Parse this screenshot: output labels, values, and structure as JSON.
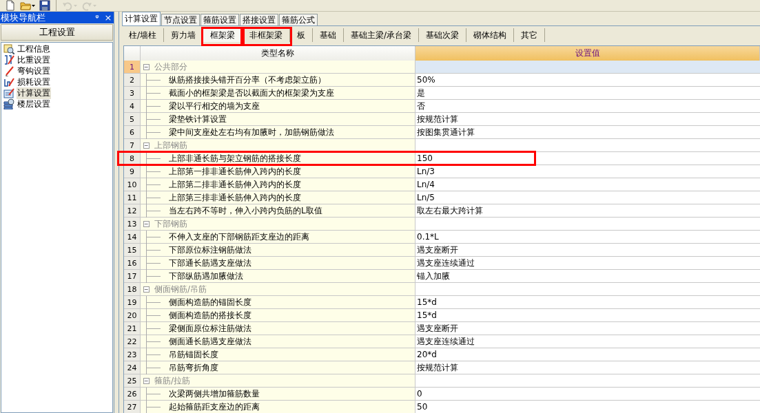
{
  "toolbar": {
    "buttons": [
      {
        "kind": "new",
        "disabled": false,
        "caret": false
      },
      {
        "kind": "open",
        "disabled": false,
        "caret": true
      },
      {
        "kind": "save",
        "disabled": false,
        "caret": false
      },
      {
        "kind": "undo",
        "disabled": true,
        "caret": true
      },
      {
        "kind": "redo",
        "disabled": true,
        "caret": true
      }
    ]
  },
  "nav_panel": {
    "title": "模块导航栏",
    "pin": "ᵠ",
    "close": "×",
    "section": "工程设置",
    "items": [
      {
        "label": "工程信息",
        "kind": "info",
        "selected": false
      },
      {
        "label": "比重设置",
        "kind": "weight",
        "selected": false
      },
      {
        "label": "弯钩设置",
        "kind": "hook",
        "selected": false
      },
      {
        "label": "损耗设置",
        "kind": "loss",
        "selected": false
      },
      {
        "label": "计算设置",
        "kind": "calc",
        "selected": true
      },
      {
        "label": "楼层设置",
        "kind": "floor",
        "selected": false
      }
    ]
  },
  "tabs": [
    {
      "label": "计算设置",
      "selected": true
    },
    {
      "label": "节点设置",
      "selected": false
    },
    {
      "label": "箍筋设置",
      "selected": false
    },
    {
      "label": "搭接设置",
      "selected": false
    },
    {
      "label": "箍筋公式",
      "selected": false
    }
  ],
  "subtabs": [
    {
      "label": "柱/墙柱",
      "selected": false,
      "highlighted": false
    },
    {
      "label": "剪力墙",
      "selected": false,
      "highlighted": false
    },
    {
      "label": "框架梁",
      "selected": true,
      "highlighted": true
    },
    {
      "label": "非框架梁",
      "selected": false,
      "highlighted": true
    },
    {
      "label": "板",
      "selected": false,
      "highlighted": false
    },
    {
      "label": "基础",
      "selected": false,
      "highlighted": false
    },
    {
      "label": "基础主梁/承台梁",
      "selected": false,
      "highlighted": false
    },
    {
      "label": "基础次梁",
      "selected": false,
      "highlighted": false
    },
    {
      "label": "砌体结构",
      "selected": false,
      "highlighted": false
    },
    {
      "label": "其它",
      "selected": false,
      "highlighted": false
    }
  ],
  "table": {
    "columns": [
      "类型名称",
      "设置值"
    ],
    "rows": [
      {
        "num": "1",
        "kind": "group",
        "toggle": "−",
        "name": "公共部分",
        "selected": true,
        "highlighted": false
      },
      {
        "num": "2",
        "kind": "item",
        "name": "纵筋搭接接头错开百分率（不考虑架立筋）",
        "value": "50%",
        "selected": false,
        "highlighted": false
      },
      {
        "num": "3",
        "kind": "item",
        "name": "截面小的框架梁是否以截面大的框架梁为支座",
        "value": "是",
        "selected": false,
        "highlighted": false
      },
      {
        "num": "4",
        "kind": "item",
        "name": "梁以平行相交的墙为支座",
        "value": "否",
        "selected": false,
        "highlighted": false
      },
      {
        "num": "5",
        "kind": "item",
        "name": "梁垫铁计算设置",
        "value": "按规范计算",
        "selected": false,
        "highlighted": false
      },
      {
        "num": "6",
        "kind": "item",
        "name": "梁中间支座处左右均有加腋时，加筋钢筋做法",
        "value": "按图集贯通计算",
        "selected": false,
        "highlighted": false
      },
      {
        "num": "7",
        "kind": "group",
        "toggle": "−",
        "name": "上部钢筋",
        "selected": false,
        "highlighted": false
      },
      {
        "num": "8",
        "kind": "item",
        "name": "上部非通长筋与架立钢筋的搭接长度",
        "value": "150",
        "selected": false,
        "highlighted": true
      },
      {
        "num": "9",
        "kind": "item",
        "name": "上部第一排非通长筋伸入跨内的长度",
        "value": "Ln/3",
        "selected": false,
        "highlighted": false
      },
      {
        "num": "10",
        "kind": "item",
        "name": "上部第二排非通长筋伸入跨内的长度",
        "value": "Ln/4",
        "selected": false,
        "highlighted": false
      },
      {
        "num": "11",
        "kind": "item",
        "name": "上部第三排非通长筋伸入跨内的长度",
        "value": "Ln/5",
        "selected": false,
        "highlighted": false
      },
      {
        "num": "12",
        "kind": "item",
        "name": "当左右跨不等时，伸入小跨内负筋的L取值",
        "value": "取左右最大跨计算",
        "selected": false,
        "highlighted": false
      },
      {
        "num": "13",
        "kind": "group",
        "toggle": "−",
        "name": "下部钢筋",
        "selected": false,
        "highlighted": false
      },
      {
        "num": "14",
        "kind": "item",
        "name": "不伸入支座的下部钢筋距支座边的距离",
        "value": "0.1*L",
        "selected": false,
        "highlighted": false
      },
      {
        "num": "15",
        "kind": "item",
        "name": "下部原位标注钢筋做法",
        "value": "遇支座断开",
        "selected": false,
        "highlighted": false
      },
      {
        "num": "16",
        "kind": "item",
        "name": "下部通长筋遇支座做法",
        "value": "遇支座连续通过",
        "selected": false,
        "highlighted": false
      },
      {
        "num": "17",
        "kind": "item",
        "name": "下部纵筋遇加腋做法",
        "value": "锚入加腋",
        "selected": false,
        "highlighted": false
      },
      {
        "num": "18",
        "kind": "group",
        "toggle": "−",
        "name": "侧面钢筋/吊筋",
        "selected": false,
        "highlighted": false
      },
      {
        "num": "19",
        "kind": "item",
        "name": "侧面构造筋的锚固长度",
        "value": "15*d",
        "selected": false,
        "highlighted": false
      },
      {
        "num": "20",
        "kind": "item",
        "name": "侧面构造筋的搭接长度",
        "value": "15*d",
        "selected": false,
        "highlighted": false
      },
      {
        "num": "21",
        "kind": "item",
        "name": "梁侧面原位标注筋做法",
        "value": "遇支座断开",
        "selected": false,
        "highlighted": false
      },
      {
        "num": "22",
        "kind": "item",
        "name": "侧面通长筋遇支座做法",
        "value": "遇支座连续通过",
        "selected": false,
        "highlighted": false
      },
      {
        "num": "23",
        "kind": "item",
        "name": "吊筋锚固长度",
        "value": "20*d",
        "selected": false,
        "highlighted": false
      },
      {
        "num": "24",
        "kind": "item",
        "name": "吊筋弯折角度",
        "value": "按规范计算",
        "selected": false,
        "highlighted": false
      },
      {
        "num": "25",
        "kind": "group",
        "toggle": "−",
        "name": "箍筋/拉筋",
        "selected": false,
        "highlighted": false
      },
      {
        "num": "26",
        "kind": "item",
        "name": "次梁两侧共增加箍筋数量",
        "value": "0",
        "selected": false,
        "highlighted": false
      },
      {
        "num": "27",
        "kind": "item",
        "name": "起始箍筋距支座边的距离",
        "value": "50",
        "selected": false,
        "highlighted": false
      }
    ]
  }
}
